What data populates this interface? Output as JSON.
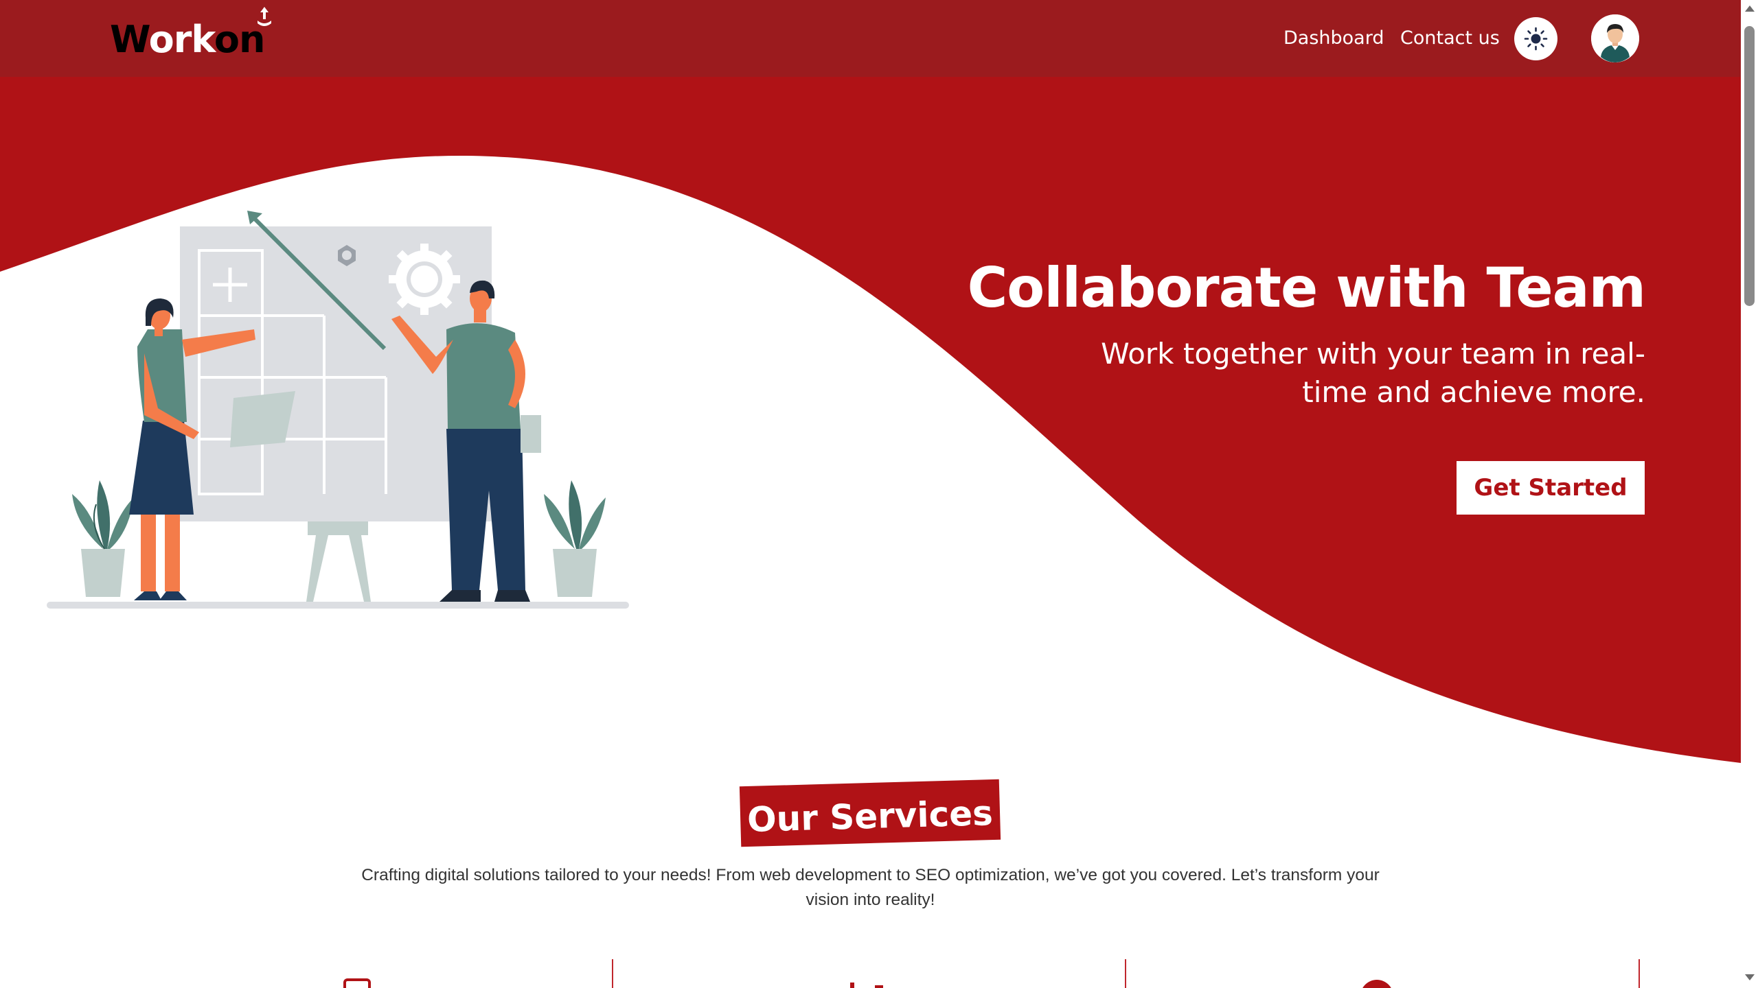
{
  "navbar": {
    "logo": {
      "part1": "W",
      "part2": "ork",
      "part3": "on"
    },
    "links": {
      "dashboard": "Dashboard",
      "contact": "Contact us"
    },
    "theme_icon": "sun-icon",
    "avatar_icon": "user-avatar-icon"
  },
  "hero": {
    "title": "Collaborate with Team",
    "subtitle": "Work together with your team in real-time and achieve more.",
    "cta_label": "Get Started",
    "illustration": "team-collaboration-illustration"
  },
  "services": {
    "title": "Our Services",
    "description": "Crafting digital solutions tailored to your needs! From web development to SEO optimization, we’ve got you covered. Let’s transform your vision into reality!",
    "icons": [
      "device-icon",
      "chart-icon",
      "target-icon"
    ]
  },
  "colors": {
    "navbar_bg": "#9b1b1e",
    "hero_red": "#b01216",
    "white": "#ffffff",
    "figure_teal": "#5b8a80",
    "figure_navy": "#1e3a5c",
    "skin_orange": "#f47c4a",
    "board_gray": "#dcdee2"
  }
}
